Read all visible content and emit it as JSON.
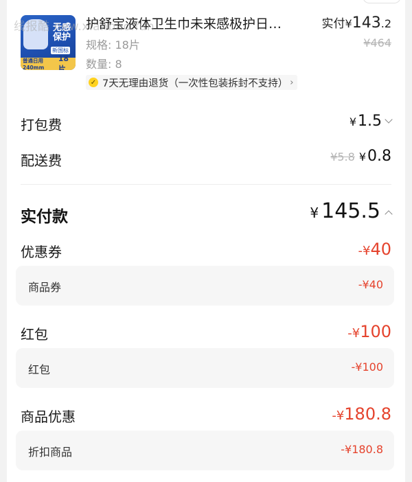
{
  "watermark": "线报酷 new.xianbao.fun",
  "product": {
    "image": {
      "badge_line1": "无感",
      "badge_line2": "保护",
      "tag": "新国标",
      "bottom_left": "普通日用240mm",
      "bottom_right": "18片"
    },
    "title": "护舒宝液体卫生巾未来感极护日…",
    "spec": "规格: 18片",
    "quantity": "数量: 8",
    "paid_label": "实付",
    "paid_currency": "¥",
    "paid_int": "143",
    "paid_dec": ".2",
    "original_price": "¥464",
    "return_policy": "7天无理由退货（一次性包装拆封不支持）"
  },
  "fees": {
    "packing": {
      "label": "打包费",
      "currency": "¥",
      "value": "1.5"
    },
    "delivery": {
      "label": "配送费",
      "original": "¥5.8",
      "currency": "¥",
      "value": "0.8"
    }
  },
  "total": {
    "label": "实付款",
    "currency": "¥",
    "value": "145.5"
  },
  "discounts": [
    {
      "label": "优惠券",
      "neg": "-¥",
      "value": "40",
      "sub_label": "商品券",
      "sub_value": "-¥40"
    },
    {
      "label": "红包",
      "neg": "-¥",
      "value": "100",
      "sub_label": "红包",
      "sub_value": "-¥100"
    },
    {
      "label": "商品优惠",
      "neg": "-¥",
      "value": "180.8",
      "sub_label": "折扣商品",
      "sub_value": "-¥180.8"
    }
  ],
  "colors": {
    "accent_red": "#e5432d",
    "check_yellow": "#ffd21f"
  }
}
